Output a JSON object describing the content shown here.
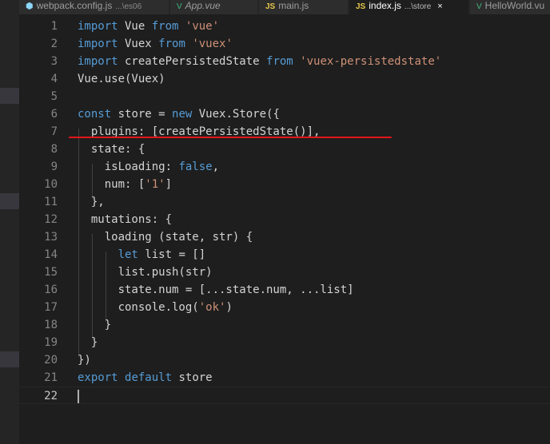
{
  "tabs": [
    {
      "icon": "webpack-icon",
      "name": "webpack.config.js",
      "path": "...\\es06",
      "active": false,
      "italic": false
    },
    {
      "icon": "vue-icon",
      "name": "App.vue",
      "path": "",
      "active": false,
      "italic": true
    },
    {
      "icon": "js-icon",
      "name": "main.js",
      "path": "",
      "active": false,
      "italic": false
    },
    {
      "icon": "js-icon",
      "name": "index.js",
      "path": "...\\store",
      "active": true,
      "italic": false,
      "close": "×"
    },
    {
      "icon": "vue-icon",
      "name": "HelloWorld.vu",
      "path": "",
      "active": false,
      "italic": false
    }
  ],
  "icon_glyphs": {
    "js": "JS",
    "vue": "V",
    "webpack": "⬢"
  },
  "editor": {
    "current_line": 22,
    "lines": [
      {
        "n": "1",
        "code": "import Vue from 'vue'"
      },
      {
        "n": "2",
        "code": "import Vuex from 'vuex'"
      },
      {
        "n": "3",
        "code": "import createPersistedState from 'vuex-persistedstate'"
      },
      {
        "n": "4",
        "code": "Vue.use(Vuex)"
      },
      {
        "n": "5",
        "code": ""
      },
      {
        "n": "6",
        "code": "const store = new Vuex.Store({"
      },
      {
        "n": "7",
        "code": "  plugins: [createPersistedState()],"
      },
      {
        "n": "8",
        "code": "  state: {"
      },
      {
        "n": "9",
        "code": "    isLoading: false,"
      },
      {
        "n": "10",
        "code": "    num: ['1']"
      },
      {
        "n": "11",
        "code": "  },"
      },
      {
        "n": "12",
        "code": "  mutations: {"
      },
      {
        "n": "13",
        "code": "    loading (state, str) {"
      },
      {
        "n": "14",
        "code": "      let list = []"
      },
      {
        "n": "15",
        "code": "      list.push(str)"
      },
      {
        "n": "16",
        "code": "      state.num = [...state.num, ...list]"
      },
      {
        "n": "17",
        "code": "      console.log('ok')"
      },
      {
        "n": "18",
        "code": "    }"
      },
      {
        "n": "19",
        "code": "  }"
      },
      {
        "n": "20",
        "code": "})"
      },
      {
        "n": "21",
        "code": "export default store"
      },
      {
        "n": "22",
        "code": ""
      }
    ]
  },
  "colors": {
    "keyword": "#569cd6",
    "string": "#ce9178",
    "text": "#d4d4d4",
    "annotation": "#e3151a"
  }
}
